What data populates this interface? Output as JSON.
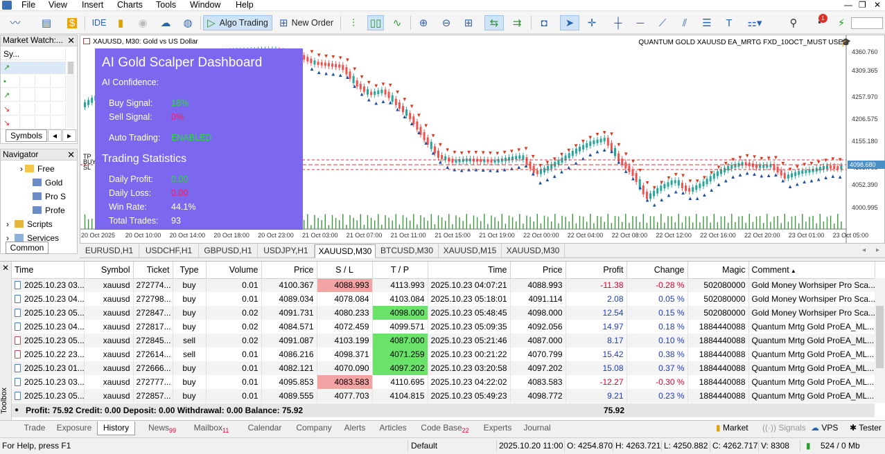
{
  "menu": {
    "items": [
      "File",
      "View",
      "Insert",
      "Charts",
      "Tools",
      "Window",
      "Help"
    ]
  },
  "toolbar": {
    "ide": "IDE",
    "algo_trading": "Algo Trading",
    "new_order": "New Order",
    "notif_count": "1"
  },
  "market_watch": {
    "title": "Market Watch:...",
    "header": "Sy...",
    "tab_label": "Symbols"
  },
  "navigator": {
    "title": "Navigator",
    "items": [
      "Free",
      "Gold",
      "Pro S",
      "Profe",
      "Scripts",
      "Services"
    ],
    "tab_label": "Common"
  },
  "chart": {
    "symbol_info": "XAUUSD, M30:  Gold vs US Dollar",
    "ea_name": "QUANTUM GOLD XAUUSD EA_MRTG FXD_10OCT_MUST USE",
    "price_ticks": [
      "4360.760",
      "4309.365",
      "4257.970",
      "4206.575",
      "4155.180",
      "4103.785",
      "4052.390",
      "4000.995"
    ],
    "current_price": "4098.680",
    "time_ticks": [
      "20 Oct 2025",
      "20 Oct 10:00",
      "20 Oct 14:00",
      "20 Oct 18:00",
      "20 Oct 23:00",
      "21 Oct 03:00",
      "21 Oct 07:00",
      "21 Oct 11:00",
      "21 Oct 15:00",
      "21 Oct 19:00",
      "22 Oct 00:00",
      "22 Oct 04:00",
      "22 Oct 08:00",
      "22 Oct 12:00",
      "22 Oct 16:00",
      "22 Oct 20:00",
      "23 Oct 01:00",
      "23 Oct 05:00"
    ],
    "level_labels": [
      "TP",
      "BUY",
      "SL"
    ],
    "up_color": "#26a69a",
    "down_color": "#ef5350",
    "buy_arrow_color": "#1e4fa0",
    "sell_arrow_color": "#d63a1e"
  },
  "dashboard": {
    "title": "AI Gold Scalper Dashboard",
    "confidence_label": "AI Confidence:",
    "buy_label": "Buy Signal:",
    "buy_value": "18%",
    "sell_label": "Sell Signal:",
    "sell_value": "0%",
    "auto_label": "Auto Trading:",
    "auto_value": "ENABLED",
    "stats_title": "Trading Statistics",
    "profit_label": "Daily Profit:",
    "profit_value": "0.00",
    "loss_label": "Daily Loss:",
    "loss_value": "0.00",
    "winrate_label": "Win Rate:",
    "winrate_value": "44.1%",
    "trades_label": "Total Trades:",
    "trades_value": "93",
    "bg_color": "#7b68ee"
  },
  "symbol_tabs": [
    "EURUSD,H1",
    "USDCHF,H1",
    "GBPUSD,H1",
    "USDJPY,H1",
    "XAUUSD,M30",
    "BTCUSD,M30",
    "XAUUSD,M15",
    "XAUUSD,M30"
  ],
  "history": {
    "columns": [
      "Time",
      "Symbol",
      "Ticket",
      "Type",
      "Volume",
      "Price",
      "S / L",
      "T / P",
      "Time",
      "Price",
      "Profit",
      "Change",
      "Magic",
      "Comment"
    ],
    "rows": [
      {
        "open_time": "2025.10.23 03...",
        "symbol": "xauusd",
        "ticket": "272774...",
        "type": "buy",
        "volume": "0.01",
        "price": "4100.367",
        "sl": "4088.993",
        "tp": "4113.993",
        "close_time": "2025.10.23 04:07:21",
        "close_price": "4088.993",
        "profit": "-11.38",
        "change": "-0.28 %",
        "magic": "502080000",
        "comment": "Gold Money Worhsiper Pro Sca...",
        "hit": "sl"
      },
      {
        "open_time": "2025.10.23 04...",
        "symbol": "xauusd",
        "ticket": "272798...",
        "type": "buy",
        "volume": "0.01",
        "price": "4089.034",
        "sl": "4078.084",
        "tp": "4103.084",
        "close_time": "2025.10.23 05:18:01",
        "close_price": "4091.114",
        "profit": "2.08",
        "change": "0.05 %",
        "magic": "502080000",
        "comment": "Gold Money Worhsiper Pro Sca...",
        "hit": ""
      },
      {
        "open_time": "2025.10.23 05...",
        "symbol": "xauusd",
        "ticket": "272847...",
        "type": "buy",
        "volume": "0.02",
        "price": "4091.731",
        "sl": "4080.233",
        "tp": "4098.000",
        "close_time": "2025.10.23 05:48:45",
        "close_price": "4098.000",
        "profit": "12.54",
        "change": "0.15 %",
        "magic": "502080000",
        "comment": "Gold Money Worhsiper Pro Sca...",
        "hit": "tp"
      },
      {
        "open_time": "2025.10.23 04...",
        "symbol": "xauusd",
        "ticket": "272817...",
        "type": "buy",
        "volume": "0.02",
        "price": "4084.571",
        "sl": "4072.459",
        "tp": "4099.571",
        "close_time": "2025.10.23 05:09:35",
        "close_price": "4092.056",
        "profit": "14.97",
        "change": "0.18 %",
        "magic": "1884440088",
        "comment": "Quantum Mrtg Gold ProEA_ML...",
        "hit": ""
      },
      {
        "open_time": "2025.10.23 05...",
        "symbol": "xauusd",
        "ticket": "272845...",
        "type": "sell",
        "volume": "0.02",
        "price": "4091.087",
        "sl": "4103.199",
        "tp": "4087.000",
        "close_time": "2025.10.23 05:21:46",
        "close_price": "4087.000",
        "profit": "8.17",
        "change": "0.10 %",
        "magic": "1884440088",
        "comment": "Quantum Mrtg Gold ProEA_ML...",
        "hit": "tp"
      },
      {
        "open_time": "2025.10.22 23...",
        "symbol": "xauusd",
        "ticket": "272614...",
        "type": "sell",
        "volume": "0.01",
        "price": "4086.216",
        "sl": "4098.371",
        "tp": "4071.259",
        "close_time": "2025.10.23 00:21:22",
        "close_price": "4070.799",
        "profit": "15.42",
        "change": "0.38 %",
        "magic": "1884440088",
        "comment": "Quantum Mrtg Gold ProEA_ML...",
        "hit": "tp"
      },
      {
        "open_time": "2025.10.23 01...",
        "symbol": "xauusd",
        "ticket": "272666...",
        "type": "buy",
        "volume": "0.01",
        "price": "4082.121",
        "sl": "4070.090",
        "tp": "4097.202",
        "close_time": "2025.10.23 03:20:58",
        "close_price": "4097.202",
        "profit": "15.08",
        "change": "0.37 %",
        "magic": "1884440088",
        "comment": "Quantum Mrtg Gold ProEA_ML...",
        "hit": "tp"
      },
      {
        "open_time": "2025.10.23 03...",
        "symbol": "xauusd",
        "ticket": "272777...",
        "type": "buy",
        "volume": "0.01",
        "price": "4095.853",
        "sl": "4083.583",
        "tp": "4110.695",
        "close_time": "2025.10.23 04:22:02",
        "close_price": "4083.583",
        "profit": "-12.27",
        "change": "-0.30 %",
        "magic": "1884440088",
        "comment": "Quantum Mrtg Gold ProEA_ML...",
        "hit": "sl"
      },
      {
        "open_time": "2025.10.23 05...",
        "symbol": "xauusd",
        "ticket": "272857...",
        "type": "buy",
        "volume": "0.01",
        "price": "4089.555",
        "sl": "4077.703",
        "tp": "4104.815",
        "close_time": "2025.10.23 05:49:23",
        "close_price": "4098.772",
        "profit": "9.21",
        "change": "0.23 %",
        "magic": "1884440088",
        "comment": "Quantum Mrtg Gold ProEA_ML...",
        "hit": ""
      }
    ],
    "summary": "Profit: 75.92  Credit: 0.00  Deposit: 0.00  Withdrawal: 0.00  Balance: 75.92",
    "summary_profit": "75.92"
  },
  "toolbox_label": "Toolbox",
  "bottom_tabs": [
    {
      "label": "Trade",
      "badge": ""
    },
    {
      "label": "Exposure",
      "badge": ""
    },
    {
      "label": "History",
      "badge": ""
    },
    {
      "label": "News",
      "badge": "99"
    },
    {
      "label": "Mailbox",
      "badge": "11"
    },
    {
      "label": "Calendar",
      "badge": ""
    },
    {
      "label": "Company",
      "badge": ""
    },
    {
      "label": "Alerts",
      "badge": ""
    },
    {
      "label": "Articles",
      "badge": ""
    },
    {
      "label": "Code Base",
      "badge": "22"
    },
    {
      "label": "Experts",
      "badge": ""
    },
    {
      "label": "Journal",
      "badge": ""
    }
  ],
  "right_tabs": {
    "market": "Market",
    "signals": "Signals",
    "vps": "VPS",
    "tester": "Tester"
  },
  "status": {
    "help": "For Help, press F1",
    "profile": "Default",
    "datetime": "2025.10.20 11:00",
    "open": "O: 4254.870",
    "high": "H: 4263.721",
    "low": "L: 4250.882",
    "close": "C: 4262.717",
    "volume": "V: 8308",
    "traffic": "524 / 0 Mb"
  }
}
